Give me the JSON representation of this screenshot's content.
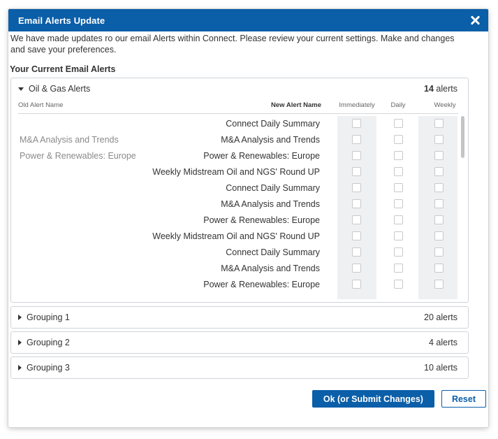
{
  "dialog": {
    "title": "Email Alerts Update",
    "intro": "We have made updates ro our email Alerts within Connect. Please review your current settings. Make and changes and save your preferences.",
    "section_heading": "Your Current Email Alerts"
  },
  "open_group": {
    "name": "Oil & Gas Alerts",
    "count": "14",
    "count_suffix": "alerts",
    "columns": {
      "old": "Old Alert Name",
      "new": "New Alert Name",
      "immediately": "Immediately",
      "daily": "Daily",
      "weekly": "Weekly"
    },
    "rows": [
      {
        "old": "",
        "new": "Connect Daily Summary"
      },
      {
        "old": "M&A Analysis and Trends",
        "new": "M&A Analysis and Trends"
      },
      {
        "old": "Power & Renewables: Europe",
        "new": "Power & Renewables: Europe"
      },
      {
        "old": "",
        "new": "Weekly Midstream Oil and NGS' Round UP"
      },
      {
        "old": "",
        "new": "Connect Daily Summary"
      },
      {
        "old": "",
        "new": "M&A Analysis and Trends"
      },
      {
        "old": "",
        "new": "Power & Renewables: Europe"
      },
      {
        "old": "",
        "new": "Weekly Midstream Oil and NGS' Round UP"
      },
      {
        "old": "",
        "new": "Connect Daily Summary"
      },
      {
        "old": "",
        "new": "M&A Analysis and Trends"
      },
      {
        "old": "",
        "new": "Power & Renewables: Europe"
      }
    ]
  },
  "closed_groups": [
    {
      "name": "Grouping 1",
      "count": "20 alerts"
    },
    {
      "name": "Grouping 2",
      "count": "4 alerts"
    },
    {
      "name": "Grouping 3",
      "count": "10 alerts"
    }
  ],
  "buttons": {
    "submit": "Ok (or Submit Changes)",
    "reset": "Reset"
  },
  "colors": {
    "primary": "#0b5ea8",
    "band": "#eef0f2"
  }
}
